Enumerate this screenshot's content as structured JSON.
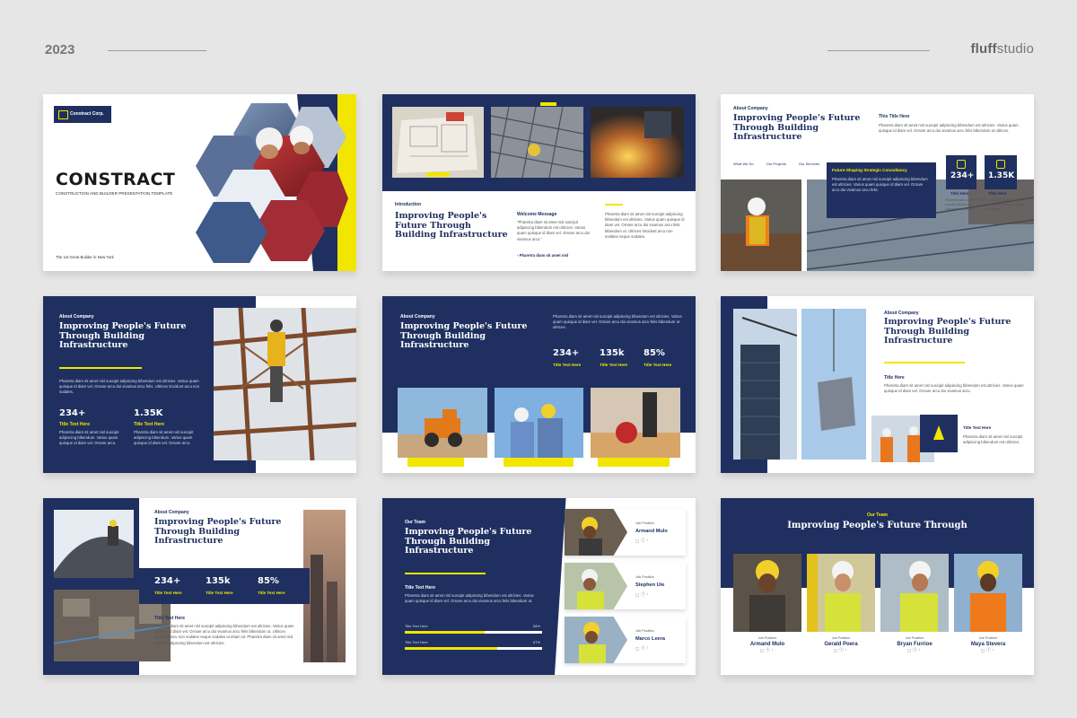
{
  "header": {
    "year": "2023",
    "brand_a": "fluff",
    "brand_b": "studio"
  },
  "s1": {
    "company": "Constract Corp.",
    "title": "CONSTRACT",
    "subtitle": "CONSTRUCTION AND BUILDER PRESENTATION TEMPLATE",
    "footer": "The 1st Great Builder in New York"
  },
  "s2": {
    "intro": "Introduction",
    "title": "Improving People's Future Through Building Infrastructure",
    "welcome": "Welcome Message",
    "quote": "\"Pharetra diam sit amet nisl suscipit adipiscing bibendum est ultricies. Varius quam quisque id diam vel. Ornare arcu dui vivamus arcu.\"",
    "sign": "- Pharetra diam sit amet nisl",
    "body": "Pharetra diam sit amet nisl suscipit adipiscing bibendum est ultricies. Varius quam quisque id diam vel. Ornare arcu dui vivamus arcu felis bibendum ut. Ultrices tincidunt arcu non sodales neque sodales."
  },
  "s3": {
    "about": "About Company",
    "title": "Improving People's Future Through Building Infrastructure",
    "tabs": [
      "What We Do",
      "Our Projects",
      "Our Services"
    ],
    "title_here": "This Title Here",
    "body": "Pharetra diam sit amet nisl suscipit adipiscing bibendum est ultricies. Varius quam quisque id diam vel. Ornare arcu dui vivamus arcu felis bibendum ut ultrices.",
    "box_title": "Future-Shaping Strategic Consultancy",
    "box_body": "Pharetra diam sit amet nisl suscipit adipiscing bibendum est ultricies. Varius quam quisque id diam vel. Ornare arcu dui vivamus arcu felis.",
    "stat1": "234+",
    "stat2": "1.35K",
    "stat_label": "Title Here",
    "stat_body": "Pharetra diam sit amet nisl suscipit adipiscing bibendum est ultricies."
  },
  "s4": {
    "about": "About Company",
    "title": "Improving People's Future Through Building Infrastructure",
    "body": "Pharetra diam sit amet nisl suscipit adipiscing bibendum est ultricies. Varius quam quisque id diam vel. Ornare arcu dui vivamus arcu felis. Ultrices tincidunt arcu non sodales.",
    "stat1": "234+",
    "stat2": "1.35K",
    "stat_label": "Title Text Here",
    "stat_body": "Pharetra diam sit amet nisl suscipit adipiscing bibendum. Varius quam quisque id diam vel. Ornare arcu."
  },
  "s5": {
    "about": "About Company",
    "title": "Improving People's Future Through Building Infrastructure",
    "body": "Pharetra diam sit amet nisl suscipit adipiscing bibendum est ultricies. Varius quam quisque id diam vel. Ornare arcu dui vivamus arcu felis bibendum ut ultrices.",
    "stats": [
      "234+",
      "135k",
      "85%"
    ],
    "stat_label": "Title Text Here"
  },
  "s6": {
    "about": "About Company",
    "title": "Improving People's Future Through Building Infrastructure",
    "title_here": "Title Here",
    "body": "Pharetra diam sit amet nisl suscipit adipiscing bibendum est ultricies. Varius quam quisque id diam vel. Ornare arcu dui vivamus arcu.",
    "text_title": "Title Text Here",
    "text_body": "Pharetra diam sit amet nisl suscipit adipiscing bibendum est ultricies."
  },
  "s7": {
    "about": "About Company",
    "title": "Improving People's Future Through Building Infrastructure",
    "stats": [
      "234+",
      "135k",
      "85%"
    ],
    "stat_label": "Title Text Here",
    "text_title": "Title Text Here",
    "body": "Pharetra diam sit amet nisl suscipit adipiscing bibendum est ultricies. Varius quam quisque id diam vel. Ornare arcu dui vivamus arcu felis bibendum ut. Ultrices tincidunt arcu non sodales neque sodales ut etiam sit. Pharetra diam sit amet nisl suscipit adipiscing bibendum est ultricies."
  },
  "s8": {
    "team": "Our Team",
    "title": "Improving People's Future Through Building Infrastructure",
    "text_title": "Title Text Here",
    "body": "Pharetra diam sit amet nisl suscipit adipiscing bibendum est ultricies. Varius quam quisque id diam vel. Ornare arcu dui vivamus arcu felis bibendum ut.",
    "bars": [
      {
        "label": "Title Text Here",
        "value": "58%",
        "fraction": 0.58
      },
      {
        "label": "Title Text Here",
        "value": "67%",
        "fraction": 0.67
      }
    ],
    "members": [
      {
        "position": "Job Position",
        "name": "Armand Mulo"
      },
      {
        "position": "Job Position",
        "name": "Stephen Uie"
      },
      {
        "position": "Job Position",
        "name": "Marco Leera"
      }
    ]
  },
  "s9": {
    "team": "Our Team",
    "title": "Improving People's Future Through",
    "members": [
      {
        "position": "Job Position",
        "name": "Armand Mulo"
      },
      {
        "position": "Job Position",
        "name": "Gerald Poera"
      },
      {
        "position": "Job Position",
        "name": "Bryan Furrioe"
      },
      {
        "position": "Job Position",
        "name": "Maya Stevera"
      }
    ]
  },
  "colors": {
    "navy": "#1f3060",
    "yellow": "#f2e600",
    "background": "#e6e6e6"
  },
  "icons": [
    "social-instagram-icon",
    "social-facebook-icon",
    "social-twitter-icon",
    "helmet-icon",
    "cone-icon"
  ]
}
